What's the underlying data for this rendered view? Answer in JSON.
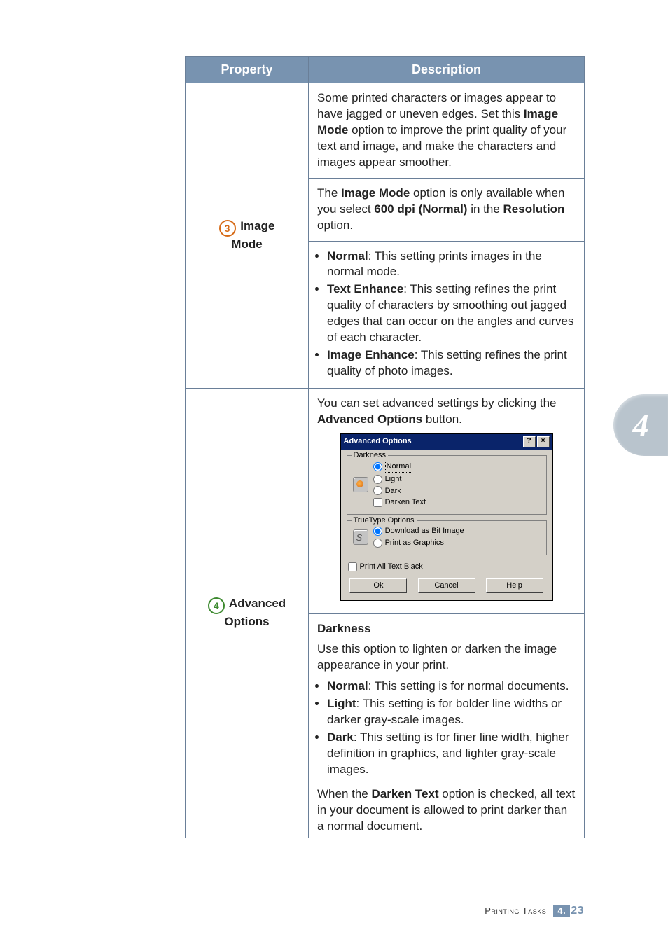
{
  "side_tab": "4",
  "table": {
    "headers": {
      "property": "Property",
      "description": "Description"
    },
    "rows": [
      {
        "badge": "3",
        "prop_line1": "Image",
        "prop_line2": "Mode",
        "blocks": [
          {
            "html": "Some printed characters or images appear to have jagged or uneven edges. Set this <b>Image Mode</b> option to improve the print quality of your text and image, and make the characters and images appear smoother."
          },
          {
            "html": "The <b>Image Mode</b> option is only available when you select <b>600 dpi (Normal)</b> in the <b>Resolution</b> option."
          },
          {
            "list": [
              "<b>Normal</b>: This setting prints images in the normal mode.",
              "<b>Text Enhance</b>: This setting refines the print quality of characters by smoothing out jagged edges that can occur on the angles and curves of each character.",
              "<b>Image Enhance</b>: This setting refines the print quality of photo images."
            ]
          }
        ]
      },
      {
        "badge": "4",
        "prop_line1": "Advanced",
        "prop_line2": "Options",
        "intro_html": "You can set advanced settings by clicking the <b>Advanced Options</b> button.",
        "dialog": {
          "title": "Advanced Options",
          "darkness_legend": "Darkness",
          "darkness_options": {
            "normal": "Normal",
            "light": "Light",
            "dark": "Dark"
          },
          "darken_text": "Darken Text",
          "truetype_legend": "TrueType Options",
          "truetype_options": {
            "bit": "Download as Bit Image",
            "graphics": "Print as Graphics"
          },
          "print_black": "Print All Text Black",
          "buttons": {
            "ok": "Ok",
            "cancel": "Cancel",
            "help": "Help"
          }
        },
        "sections": [
          {
            "title": "Darkness"
          },
          {
            "html": "Use this option to lighten or darken the image appearance in your print."
          },
          {
            "list": [
              "<b>Normal</b>: This setting is for normal documents.",
              "<b>Light</b>: This setting is for bolder line widths or darker gray-scale images.",
              "<b>Dark</b>: This setting is for finer line width, higher definition in graphics, and lighter gray-scale images."
            ]
          },
          {
            "html": "When the <b>Darken Text</b> option is checked, all text in your document is allowed to print darker than a normal document."
          }
        ]
      }
    ]
  },
  "footer": {
    "label": "Printing Tasks",
    "chapter": "4.",
    "page": "23"
  }
}
